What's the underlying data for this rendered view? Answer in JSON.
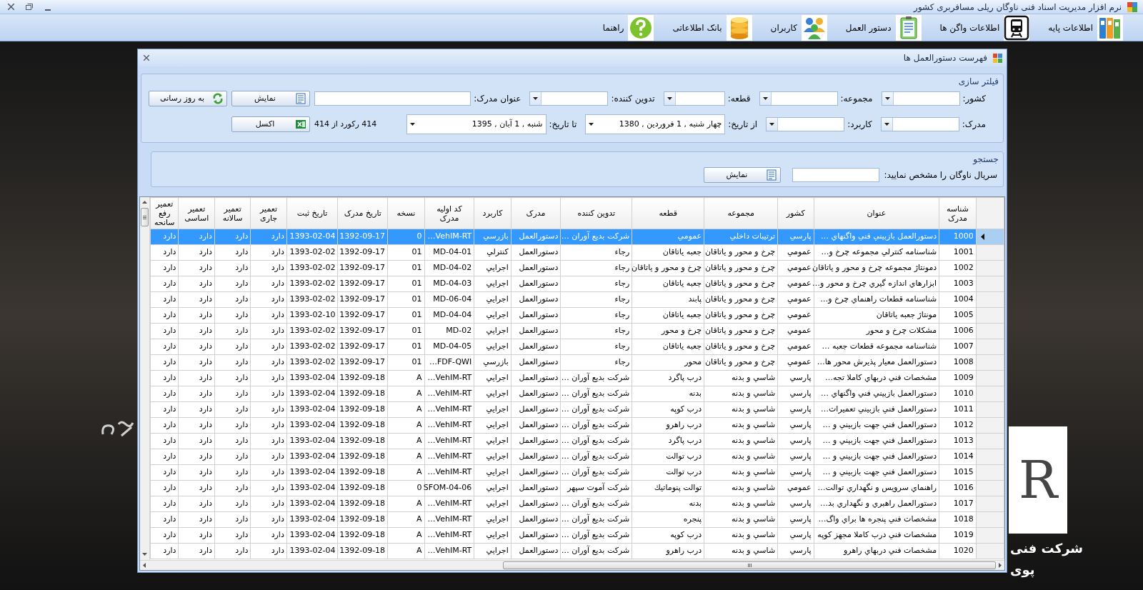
{
  "app_title": "نرم افزار مدیریت اسناد فنی ناوگان ریلی مسافربری کشور",
  "toolbar": [
    {
      "label": "اطلاعات پایه",
      "kind": "binders"
    },
    {
      "label": "اطلاعات واگن ها",
      "kind": "train"
    },
    {
      "label": "دستور العمل",
      "kind": "clipboard"
    },
    {
      "label": "کاربران",
      "kind": "users"
    },
    {
      "label": "بانک اطلاعاتی",
      "kind": "database"
    },
    {
      "label": "راهنما",
      "kind": "help"
    }
  ],
  "wallpaper": {
    "logo_letter": "R",
    "company_lines": [
      "شرکت فنی",
      "پوی"
    ]
  },
  "window": {
    "title": "فهرست دستورالعمل ها"
  },
  "filter": {
    "legend": "فیلتر سازی",
    "fields": [
      {
        "kind": "combo",
        "label": "کشور:"
      },
      {
        "kind": "combo",
        "label": "مجموعه:"
      },
      {
        "kind": "combo",
        "label": "قطعه:"
      },
      {
        "kind": "combo",
        "label": "تدوین کننده:"
      },
      {
        "kind": "text",
        "label": "عنوان مدرک:"
      },
      {
        "kind": "combo",
        "label": "مدرک:"
      },
      {
        "kind": "combo",
        "label": "کاربرد:"
      },
      {
        "kind": "date",
        "label": "از تاریخ:",
        "value": "چهار شنبه , 1  فروردین , 1380"
      },
      {
        "kind": "date",
        "label": "تا تاریخ:",
        "value": "شنبه , 1  آبان , 1395"
      },
      {
        "kind": "count",
        "text": "414 رکورد از 414"
      }
    ],
    "buttons": [
      {
        "label": "نمایش",
        "kind": "sheet"
      },
      {
        "label": "به روز رسانی",
        "kind": "refresh"
      },
      {
        "label": "اکسل",
        "kind": "excel"
      }
    ]
  },
  "search": {
    "legend": "جستجو",
    "label": "سریال ناوگان را مشخص نمایید:",
    "button": {
      "label": "نمایش",
      "kind": "sheet"
    }
  },
  "table": {
    "columns": [
      "شناسه مدرک",
      "عنوان",
      "کشور",
      "مجموعه",
      "قطعه",
      "تدوین کننده",
      "مدرک",
      "کاربرد",
      "کد اولیه مدرک",
      "نسخه",
      "تاریخ مدرک",
      "تاریخ ثبت",
      "تعمیر جاری",
      "تعمیر سالانه",
      "تعمیر اساسی",
      "تعمیر رفع سانحه"
    ],
    "rows": [
      {
        "selected": true,
        "cells": [
          "1000",
          "دستورالعمل بازبيني فني واگنهاي …",
          "پارسي",
          "ترتيبات داخلي",
          "عمومي",
          "شرکت بديع آوران …",
          "دستورالعمل",
          "بازرسي",
          "VehIM-RT…",
          "0",
          "1392-09-17",
          "1393-02-04",
          "دارد",
          "دارد",
          "دارد",
          "دارد"
        ]
      },
      {
        "selected": false,
        "cells": [
          "1001",
          "شناسنامه کنترلي مجموعه چرخ و…",
          "عمومي",
          "چرخ و محور و ياتاقان",
          "جعبه ياتاقان",
          "رجاء",
          "دستورالعمل",
          "کنترلي",
          "MD-04-01",
          "01",
          "1392-09-17",
          "1393-02-02",
          "دارد",
          "دارد",
          "دارد",
          "دارد"
        ]
      },
      {
        "selected": false,
        "cells": [
          "1002",
          "دمونتاژ مجموعه چرخ و محور و ياتاقان",
          "عمومي",
          "چرخ و محور و ياتاقان",
          "چرخ و محور و ياتاقان",
          "رجاء",
          "دستورالعمل",
          "اجرايي",
          "MD-04-02",
          "01",
          "1392-09-17",
          "1393-02-02",
          "دارد",
          "دارد",
          "دارد",
          "دارد"
        ]
      },
      {
        "selected": false,
        "cells": [
          "1003",
          "ابزارهاي اندازه گيري چرخ و محور و…",
          "عمومي",
          "چرخ و محور و ياتاقان",
          "جعبه ياتاقان",
          "رجاء",
          "دستورالعمل",
          "اجرايي",
          "MD-04-03",
          "01",
          "1392-09-17",
          "1393-02-02",
          "دارد",
          "دارد",
          "دارد",
          "دارد"
        ]
      },
      {
        "selected": false,
        "cells": [
          "1004",
          "شناسنامه قطعات راهنماي چرخ و…",
          "عمومي",
          "چرخ و محور و ياتاقان",
          "پابند",
          "رجاء",
          "دستورالعمل",
          "اجرايي",
          "MD-06-04",
          "01",
          "1392-09-17",
          "1393-02-02",
          "دارد",
          "دارد",
          "دارد",
          "دارد"
        ]
      },
      {
        "selected": false,
        "cells": [
          "1005",
          "مونتاژ جعبه ياتاقان",
          "عمومي",
          "چرخ و محور و ياتاقان",
          "جعبه ياتاقان",
          "رجاء",
          "دستورالعمل",
          "اجرايي",
          "MD-04-04",
          "01",
          "1392-09-17",
          "1393-02-10",
          "دارد",
          "دارد",
          "دارد",
          "دارد"
        ]
      },
      {
        "selected": false,
        "cells": [
          "1006",
          "مشکلات چرخ و محور",
          "عمومي",
          "چرخ و محور و ياتاقان",
          "چرخ و محور",
          "رجاء",
          "دستورالعمل",
          "اجرايي",
          "MD-02",
          "01",
          "1392-09-17",
          "1393-02-02",
          "دارد",
          "دارد",
          "دارد",
          "دارد"
        ]
      },
      {
        "selected": false,
        "cells": [
          "1007",
          "شناسنامه مجموعه قطعات جعبه …",
          "عمومي",
          "چرخ و محور و ياتاقان",
          "جعبه ياتاقان",
          "رجاء",
          "دستورالعمل",
          "اجرايي",
          "MD-04-05",
          "01",
          "1392-09-17",
          "1393-02-02",
          "دارد",
          "دارد",
          "دارد",
          "دارد"
        ]
      },
      {
        "selected": false,
        "cells": [
          "1008",
          "دستورالعمل معيار پذيرش محور ها…",
          "عمومي",
          "چرخ و محور و ياتاقان",
          "محور",
          "رجاء",
          "دستورالعمل",
          "بازرسي",
          "FDF-QWI…",
          "01",
          "1392-09-17",
          "1393-02-02",
          "دارد",
          "دارد",
          "دارد",
          "دارد"
        ]
      },
      {
        "selected": false,
        "cells": [
          "1009",
          "مشخصات فني دربهاي کاملا تجه…",
          "پارسي",
          "شاسي و بدنه",
          "درب پاگرد",
          "شرکت بديع آوران …",
          "دستورالعمل",
          "اجرايي",
          "VehIM-RT…",
          "A",
          "1392-09-18",
          "1393-02-04",
          "دارد",
          "دارد",
          "دارد",
          "دارد"
        ]
      },
      {
        "selected": false,
        "cells": [
          "1010",
          "دستورالعمل بازبيني فني واگنهاي …",
          "پارسي",
          "شاسي و بدنه",
          "بدنه",
          "شرکت بديع آوران …",
          "دستورالعمل",
          "اجرايي",
          "VehIM-RT…",
          "A",
          "1392-09-18",
          "1393-02-04",
          "دارد",
          "دارد",
          "دارد",
          "دارد"
        ]
      },
      {
        "selected": false,
        "cells": [
          "1011",
          "دستورالعمل فني بازبيني تعميرات…",
          "پارسي",
          "شاسي و بدنه",
          "درب کوپه",
          "شرکت بديع آوران …",
          "دستورالعمل",
          "اجرايي",
          "VehIM-RT…",
          "A",
          "1392-09-18",
          "1393-02-04",
          "دارد",
          "دارد",
          "دارد",
          "دارد"
        ]
      },
      {
        "selected": false,
        "cells": [
          "1012",
          "دستورالعمل فني جهت بازبيني و …",
          "پارسي",
          "شاسي و بدنه",
          "درب راهرو",
          "شرکت بديع آوران …",
          "دستورالعمل",
          "اجرايي",
          "VehIM-RT…",
          "A",
          "1392-09-18",
          "1393-02-04",
          "دارد",
          "دارد",
          "دارد",
          "دارد"
        ]
      },
      {
        "selected": false,
        "cells": [
          "1013",
          "دستورالعمل فني جهت بازبيني و …",
          "پارسي",
          "شاسي و بدنه",
          "درب پاگرد",
          "شرکت بديع آوران …",
          "دستورالعمل",
          "اجرايي",
          "VehIM-RT…",
          "A",
          "1392-09-18",
          "1393-02-04",
          "دارد",
          "دارد",
          "دارد",
          "دارد"
        ]
      },
      {
        "selected": false,
        "cells": [
          "1014",
          "دستورالعمل فني جهت بازبيني و …",
          "پارسي",
          "شاسي و بدنه",
          "درب توالت",
          "شرکت بديع آوران …",
          "دستورالعمل",
          "اجرايي",
          "VehIM-RT…",
          "A",
          "1392-09-18",
          "1393-02-04",
          "دارد",
          "دارد",
          "دارد",
          "دارد"
        ]
      },
      {
        "selected": false,
        "cells": [
          "1015",
          "دستورالعمل فني جهت بازبيني و …",
          "پارسي",
          "شاسي و بدنه",
          "درب توالت",
          "شرکت بديع آوران …",
          "دستورالعمل",
          "اجرايي",
          "VehIM-RT…",
          "A",
          "1392-09-18",
          "1393-02-04",
          "دارد",
          "دارد",
          "دارد",
          "دارد"
        ]
      },
      {
        "selected": false,
        "cells": [
          "1016",
          "راهنماي سرويس و نگهداري توالت…",
          "عمومي",
          "شاسي و بدنه",
          "توالت پنوماتيك",
          "شرکت آموت سپهر",
          "دستورالعمل",
          "اجرايي",
          "SFOM-04-06",
          "0",
          "1392-09-18",
          "1393-02-04",
          "دارد",
          "دارد",
          "دارد",
          "دارد"
        ]
      },
      {
        "selected": false,
        "cells": [
          "1017",
          "دستورالعمل راهبري و نگهداري بد…",
          "پارسي",
          "شاسي و بدنه",
          "بدنه",
          "شرکت بديع آوران …",
          "دستورالعمل",
          "اجرايي",
          "VehIM-RT…",
          "A",
          "1392-09-18",
          "1393-02-04",
          "دارد",
          "دارد",
          "دارد",
          "دارد"
        ]
      },
      {
        "selected": false,
        "cells": [
          "1018",
          "مشخصات فني پنجره ها براي واگ…",
          "پارسي",
          "شاسي و بدنه",
          "پنجره",
          "شرکت بديع آوران …",
          "دستورالعمل",
          "اجرايي",
          "VehIM-RT…",
          "A",
          "1392-09-18",
          "1393-02-04",
          "دارد",
          "دارد",
          "دارد",
          "دارد"
        ]
      },
      {
        "selected": false,
        "cells": [
          "1019",
          "مشخصات فني درب کاملا مجهز کوپه",
          "پارسي",
          "شاسي و بدنه",
          "درب کوپه",
          "شرکت بديع آوران …",
          "دستورالعمل",
          "اجرايي",
          "VehIM-RT…",
          "A",
          "1392-09-18",
          "1393-02-04",
          "دارد",
          "دارد",
          "دارد",
          "دارد"
        ]
      },
      {
        "selected": false,
        "cells": [
          "1020",
          "مشخصات فني دربهاي راهرو",
          "پارسي",
          "شاسي و بدنه",
          "درب راهرو",
          "شرکت بديع آوران …",
          "دستورالعمل",
          "اجرايي",
          "VehIM-RT…",
          "A",
          "1392-09-18",
          "1393-02-04",
          "دارد",
          "دارد",
          "دارد",
          "دارد"
        ]
      }
    ]
  }
}
